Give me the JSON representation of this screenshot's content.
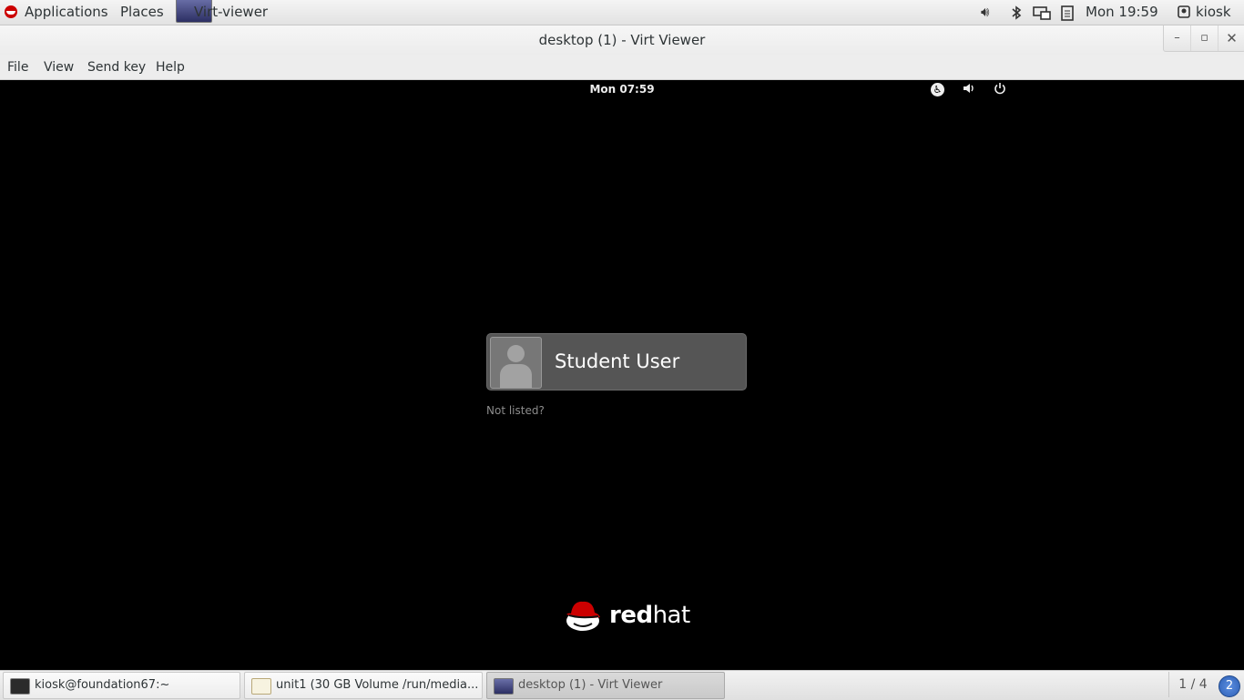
{
  "top_panel": {
    "applications_label": "Applications",
    "places_label": "Places",
    "active_app_label": "Virt-viewer",
    "clock": "Mon 19:59",
    "user": "kiosk"
  },
  "window": {
    "title": "desktop (1) - Virt Viewer",
    "buttons": {
      "minimize": "–",
      "maximize": "▫",
      "close": "✕"
    }
  },
  "menubar": {
    "file": "File",
    "view": "View",
    "send_key": "Send key",
    "help": "Help"
  },
  "guest": {
    "clock": "Mon 07:59",
    "login": {
      "user_name": "Student User",
      "not_listed": "Not listed?"
    },
    "logo": {
      "bold": "red",
      "light": "hat"
    }
  },
  "taskbar": {
    "tasks": [
      {
        "label": "kiosk@foundation67:~"
      },
      {
        "label": "unit1 (30 GB Volume /run/media..."
      },
      {
        "label": "desktop (1) - Virt Viewer"
      }
    ],
    "workspace": "1 / 4",
    "notifications": "2"
  },
  "icons": {
    "panel": [
      "redhat-menu-icon",
      "virt-viewer-icon",
      "volume-icon",
      "bluetooth-icon",
      "network-icon",
      "clipboard-icon",
      "user-icon"
    ],
    "guest": [
      "accessibility-icon",
      "volume-icon",
      "power-icon"
    ]
  },
  "colors": {
    "panel_bg": "#e9e9e9",
    "guest_bg": "#000000",
    "user_card_bg": "#555555",
    "redhat_red": "#cc0000",
    "badge_blue": "#3b6fc9"
  }
}
